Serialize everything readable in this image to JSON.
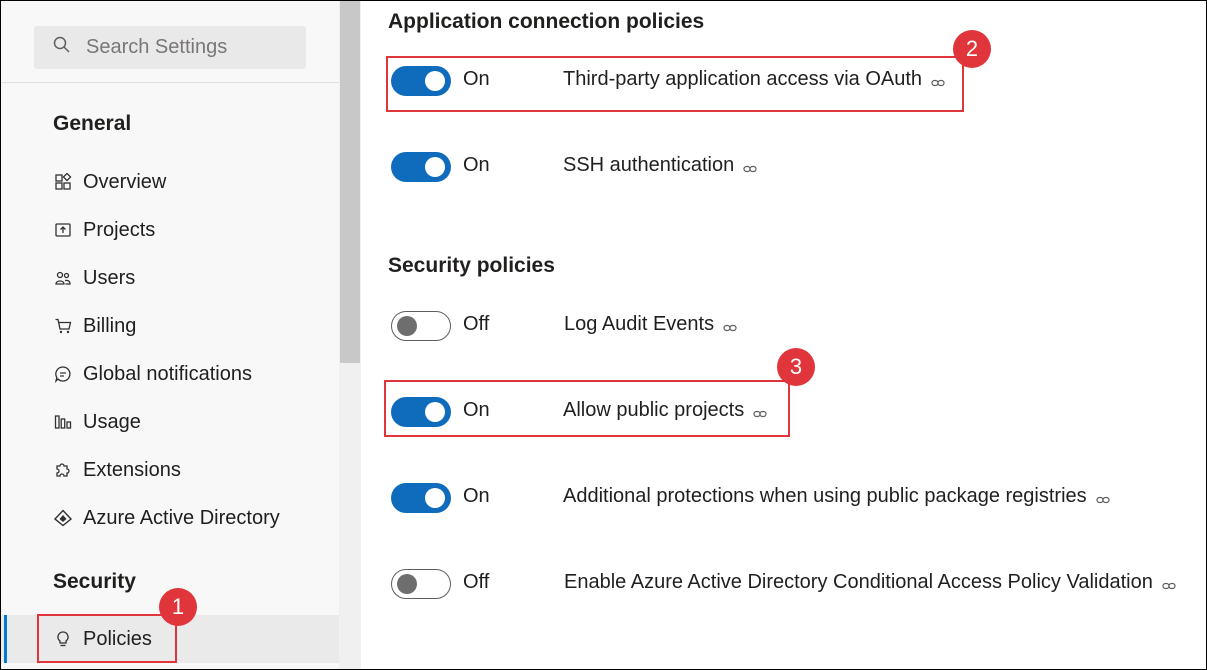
{
  "search": {
    "placeholder": "Search Settings",
    "icon": "search-icon"
  },
  "sidebar": {
    "general_title": "General",
    "general_items": [
      {
        "label": "Overview",
        "icon": "overview-icon"
      },
      {
        "label": "Projects",
        "icon": "projects-icon"
      },
      {
        "label": "Users",
        "icon": "users-icon"
      },
      {
        "label": "Billing",
        "icon": "cart-icon"
      },
      {
        "label": "Global notifications",
        "icon": "chat-icon"
      },
      {
        "label": "Usage",
        "icon": "usage-icon"
      },
      {
        "label": "Extensions",
        "icon": "puzzle-icon"
      },
      {
        "label": "Azure Active Directory",
        "icon": "azure-ad-icon"
      }
    ],
    "security_title": "Security",
    "security_items": [
      {
        "label": "Policies",
        "icon": "bulb-icon",
        "selected": true
      }
    ]
  },
  "main": {
    "app_connection_title": "Application connection policies",
    "app_connection_policies": [
      {
        "state": "On",
        "enabled": true,
        "label": "Third-party application access via OAuth"
      },
      {
        "state": "On",
        "enabled": true,
        "label": "SSH authentication"
      }
    ],
    "security_title": "Security policies",
    "security_policies": [
      {
        "state": "Off",
        "enabled": false,
        "label": "Log Audit Events"
      },
      {
        "state": "On",
        "enabled": true,
        "label": "Allow public projects"
      },
      {
        "state": "On",
        "enabled": true,
        "label": "Additional protections when using public package registries"
      },
      {
        "state": "Off",
        "enabled": false,
        "label": "Enable Azure Active Directory Conditional Access Policy Validation"
      }
    ]
  },
  "annotations": {
    "badge_1": "1",
    "badge_2": "2",
    "badge_3": "3"
  },
  "colors": {
    "accent": "#0f6cbd",
    "highlight": "#e0353b",
    "selected_bar": "#0078d4"
  }
}
